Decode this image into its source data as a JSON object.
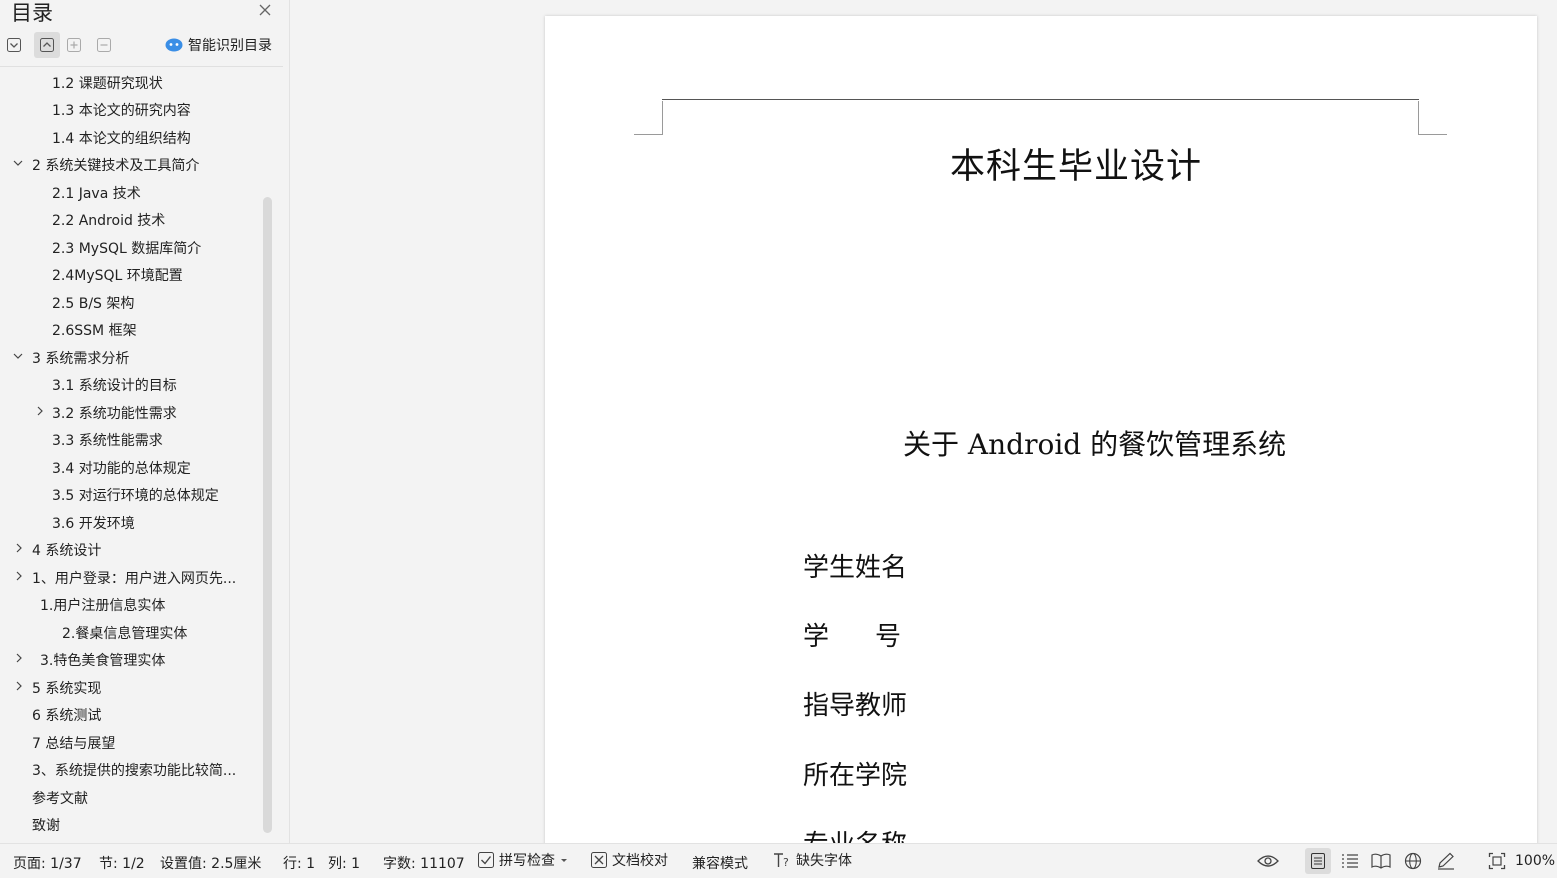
{
  "toc": {
    "title": "目录",
    "smart_label": "智能识别目录",
    "items": [
      {
        "label": "1.2 课题研究现状",
        "chevron": ""
      },
      {
        "label": "1.3 本论文的研究内容",
        "chevron": ""
      },
      {
        "label": "1.4 本论文的组织结构",
        "chevron": ""
      },
      {
        "label": "2 系统关键技术及工具简介",
        "chevron": "down"
      },
      {
        "label": "2.1 Java 技术",
        "chevron": ""
      },
      {
        "label": "2.2 Android 技术",
        "chevron": ""
      },
      {
        "label": "2.3 MySQL 数据库简介",
        "chevron": ""
      },
      {
        "label": "2.4MySQL 环境配置",
        "chevron": ""
      },
      {
        "label": "2.5 B/S 架构",
        "chevron": ""
      },
      {
        "label": "2.6SSM 框架",
        "chevron": ""
      },
      {
        "label": "3 系统需求分析",
        "chevron": "down"
      },
      {
        "label": "3.1 系统设计的目标",
        "chevron": ""
      },
      {
        "label": "3.2 系统功能性需求",
        "chevron": "right"
      },
      {
        "label": "3.3 系统性能需求",
        "chevron": ""
      },
      {
        "label": "3.4 对功能的总体规定",
        "chevron": ""
      },
      {
        "label": "3.5 对运行环境的总体规定",
        "chevron": ""
      },
      {
        "label": "3.6 开发环境",
        "chevron": ""
      },
      {
        "label": "4 系统设计",
        "chevron": "right"
      },
      {
        "label": "1、用户登录：用户进入网页先...",
        "chevron": "right"
      },
      {
        "label": "1.用户注册信息实体",
        "chevron": ""
      },
      {
        "label": "2.餐桌信息管理实体",
        "chevron": ""
      },
      {
        "label": "3.特色美食管理实体",
        "chevron": "right"
      },
      {
        "label": "5 系统实现",
        "chevron": "right"
      },
      {
        "label": "6 系统测试",
        "chevron": ""
      },
      {
        "label": "7 总结与展望",
        "chevron": ""
      },
      {
        "label": "3、系统提供的搜索功能比较简...",
        "chevron": ""
      },
      {
        "label": "参考文献",
        "chevron": ""
      },
      {
        "label": "致谢",
        "chevron": ""
      }
    ]
  },
  "document": {
    "title": "本科生毕业设计",
    "subtitle": "关于 Android 的餐饮管理系统",
    "fields": [
      "学生姓名",
      "学号",
      "指导教师",
      "所在学院",
      "专业名称"
    ]
  },
  "status": {
    "page": "页面: 1/37",
    "section": "节: 1/2",
    "setting": "设置值: 2.5厘米",
    "row": "行: 1",
    "col": "列: 1",
    "words": "字数: 11107",
    "spell": "拼写检查",
    "proof": "文档校对",
    "compat": "兼容模式",
    "missing_font": "缺失字体",
    "zoom": "100%"
  },
  "colors": {
    "accent": "#3a8ee6",
    "bar_bg": "#f3f3f3"
  }
}
